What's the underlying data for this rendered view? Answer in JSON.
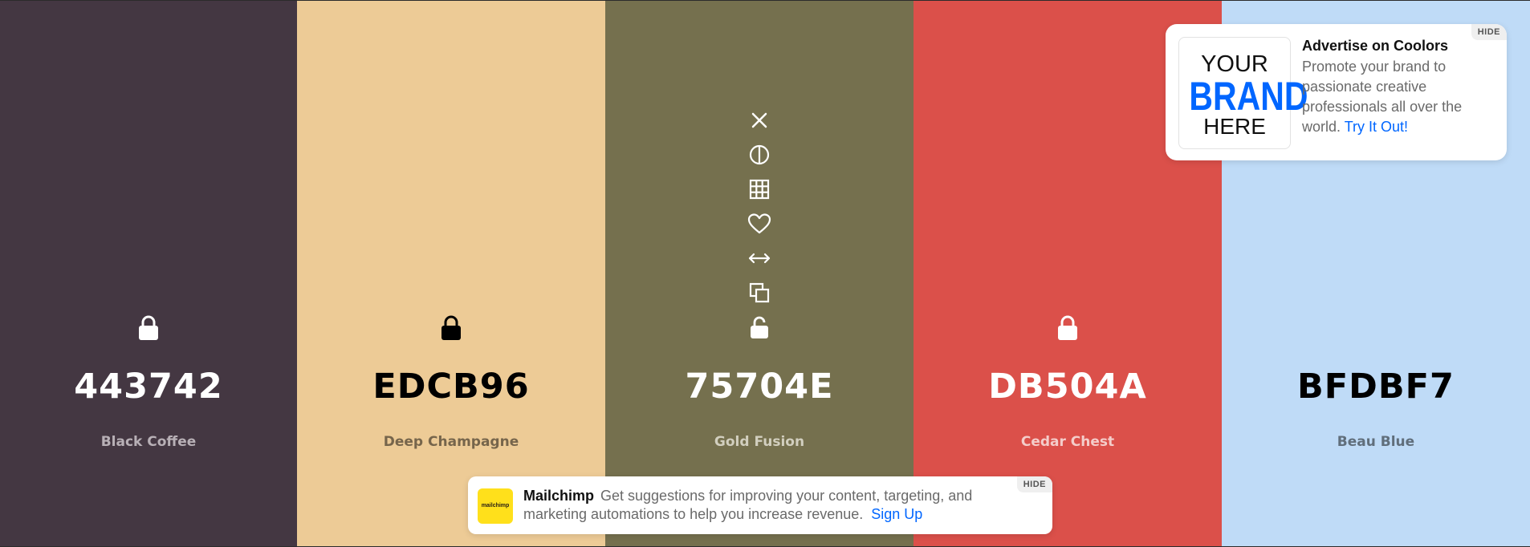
{
  "palette": {
    "swatches": [
      {
        "hex": "443742",
        "name": "Black Coffee",
        "bg": "#443742",
        "text_color": "#ffffff",
        "name_color": "#b8b0b6",
        "locked": true
      },
      {
        "hex": "EDCB96",
        "name": "Deep Champagne",
        "bg": "#EDCB96",
        "text_color": "#000000",
        "name_color": "#76654b",
        "locked": true
      },
      {
        "hex": "75704E",
        "name": "Gold Fusion",
        "bg": "#75704E",
        "text_color": "#ffffff",
        "name_color": "#d2cfbf",
        "locked": false,
        "hovered": true
      },
      {
        "hex": "DB504A",
        "name": "Cedar Chest",
        "bg": "#DB504A",
        "text_color": "#ffffff",
        "name_color": "#f4cdca",
        "locked": true
      },
      {
        "hex": "BFDBF7",
        "name": "Beau Blue",
        "bg": "#BFDBF7",
        "text_color": "#000000",
        "name_color": "#606e7b",
        "locked": false
      }
    ],
    "tool_icons": [
      "close-icon",
      "contrast-icon",
      "shades-grid-icon",
      "heart-icon",
      "drag-arrows-icon",
      "copy-icon",
      "unlock-icon"
    ]
  },
  "ad": {
    "brand_line1": "YOUR",
    "brand_line2": "BRAND",
    "brand_line3": "HERE",
    "title": "Advertise on Coolors",
    "body": "Promote your brand to passionate creative professionals all over the world.",
    "link": "Try It Out!",
    "hide": "HIDE"
  },
  "mailchimp": {
    "logo_text": "mailchimp",
    "name": "Mailchimp",
    "body": "Get suggestions for improving your content, targeting, and marketing automations to help you increase revenue.",
    "link": "Sign Up",
    "hide": "HIDE"
  },
  "colors": {
    "brand_blue": "#0066ff",
    "mailchimp_yellow": "#ffe01b"
  }
}
